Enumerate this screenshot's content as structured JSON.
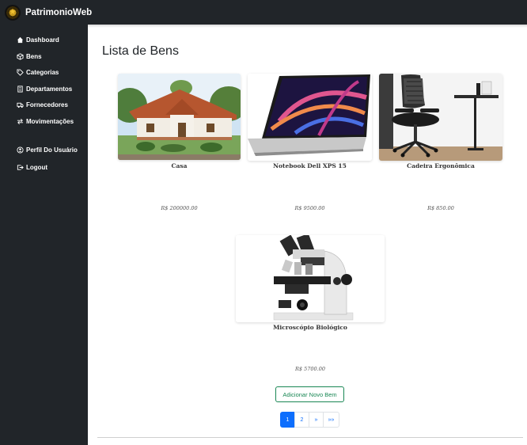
{
  "app": {
    "brand": "PatrimonioWeb"
  },
  "sidebar": {
    "items": [
      {
        "label": "Dashboard",
        "icon": "home-icon"
      },
      {
        "label": "Bens",
        "icon": "box-icon"
      },
      {
        "label": "Categorias",
        "icon": "tag-icon"
      },
      {
        "label": "Departamentos",
        "icon": "building-icon"
      },
      {
        "label": "Fornecedores",
        "icon": "truck-icon"
      },
      {
        "label": "Movimentações",
        "icon": "arrows-icon"
      },
      {
        "label": "Perfil Do Usuário",
        "icon": "user-circle-icon"
      },
      {
        "label": "Logout",
        "icon": "logout-icon"
      }
    ]
  },
  "main": {
    "title": "Lista de Bens",
    "items": [
      {
        "name": "Casa",
        "price": "R$ 200000.00",
        "image": "house-photo"
      },
      {
        "name": "Notebook Dell XPS 15",
        "price": "R$ 9500.00",
        "image": "laptop-photo"
      },
      {
        "name": "Cadeira Ergonômica",
        "price": "R$ 850.00",
        "image": "chair-photo"
      },
      {
        "name": "Microscópio Biológico",
        "price": "R$ 5700.00",
        "image": "microscope-photo"
      }
    ],
    "add_button": "Adicionar Novo Bem",
    "pagination": [
      "1",
      "2",
      "»",
      "»»"
    ],
    "active_page": "1"
  },
  "colors": {
    "sidebar": "#212529",
    "primary": "#0d6efd",
    "success": "#198754"
  }
}
